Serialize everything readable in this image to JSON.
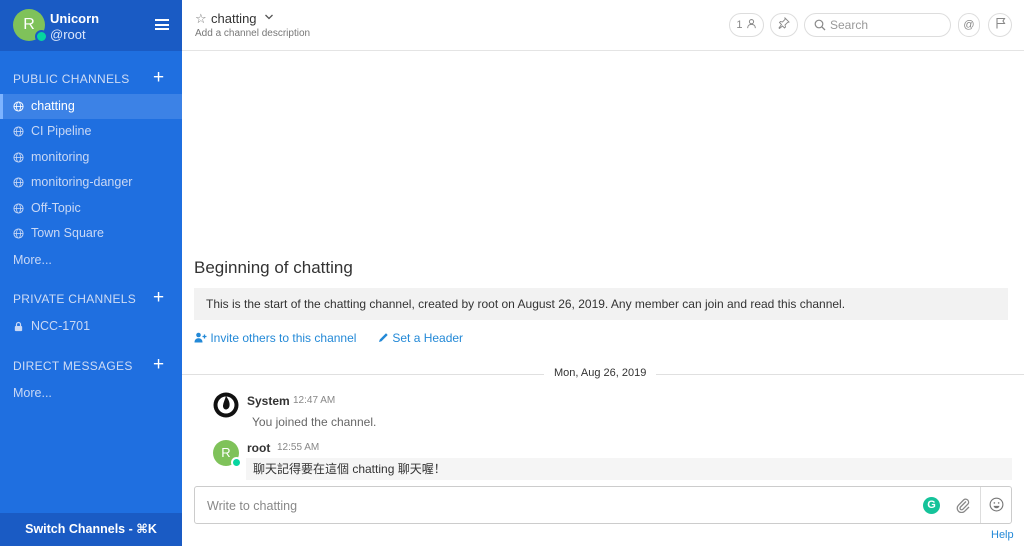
{
  "sidebar": {
    "team_initial": "R",
    "team_name": "Unicorn",
    "username": "@root",
    "public_channels_title": "PUBLIC CHANNELS",
    "public_channels": [
      {
        "label": "chatting",
        "icon": "globe-icon",
        "active": true
      },
      {
        "label": "CI Pipeline",
        "icon": "globe-icon"
      },
      {
        "label": "monitoring",
        "icon": "globe-icon"
      },
      {
        "label": "monitoring-danger",
        "icon": "globe-icon"
      },
      {
        "label": "Off-Topic",
        "icon": "globe-icon"
      },
      {
        "label": "Town Square",
        "icon": "globe-icon"
      }
    ],
    "public_more": "More...",
    "private_channels_title": "PRIVATE CHANNELS",
    "private_channels": [
      {
        "label": "NCC-1701",
        "icon": "lock-icon"
      }
    ],
    "direct_messages_title": "DIRECT MESSAGES",
    "dm_more": "More...",
    "switch_channels": "Switch Channels - ⌘K",
    "add_symbol": "+"
  },
  "header": {
    "channel_name": "chatting",
    "description": "Add a channel description",
    "member_count": "1",
    "search_placeholder": "Search"
  },
  "main": {
    "beginning_title": "Beginning of chatting",
    "intro_text": "This is the start of the chatting channel, created by root on August 26, 2019. Any member can join and read this channel.",
    "invite_label": "Invite others to this channel",
    "set_header_label": "Set a Header",
    "date_separator": "Mon, Aug 26, 2019",
    "posts": [
      {
        "user": "System",
        "time": "12:47 AM",
        "message": "You joined the channel."
      },
      {
        "user": "root",
        "avatar_initial": "R",
        "time": "12:55 AM",
        "message": "聊天記得要在這個 chatting 聊天喔！"
      }
    ],
    "composer_placeholder": "Write to chatting",
    "grammarly_letter": "G",
    "help_label": "Help"
  },
  "colors": {
    "sidebar_bg": "#1f6fe0",
    "sidebar_header_bg": "#1a5bc4",
    "active_channel_bg": "#3c82e6",
    "link": "#2389d7",
    "avatar_green": "#7fc25a",
    "online_badge": "#06d6a0"
  }
}
